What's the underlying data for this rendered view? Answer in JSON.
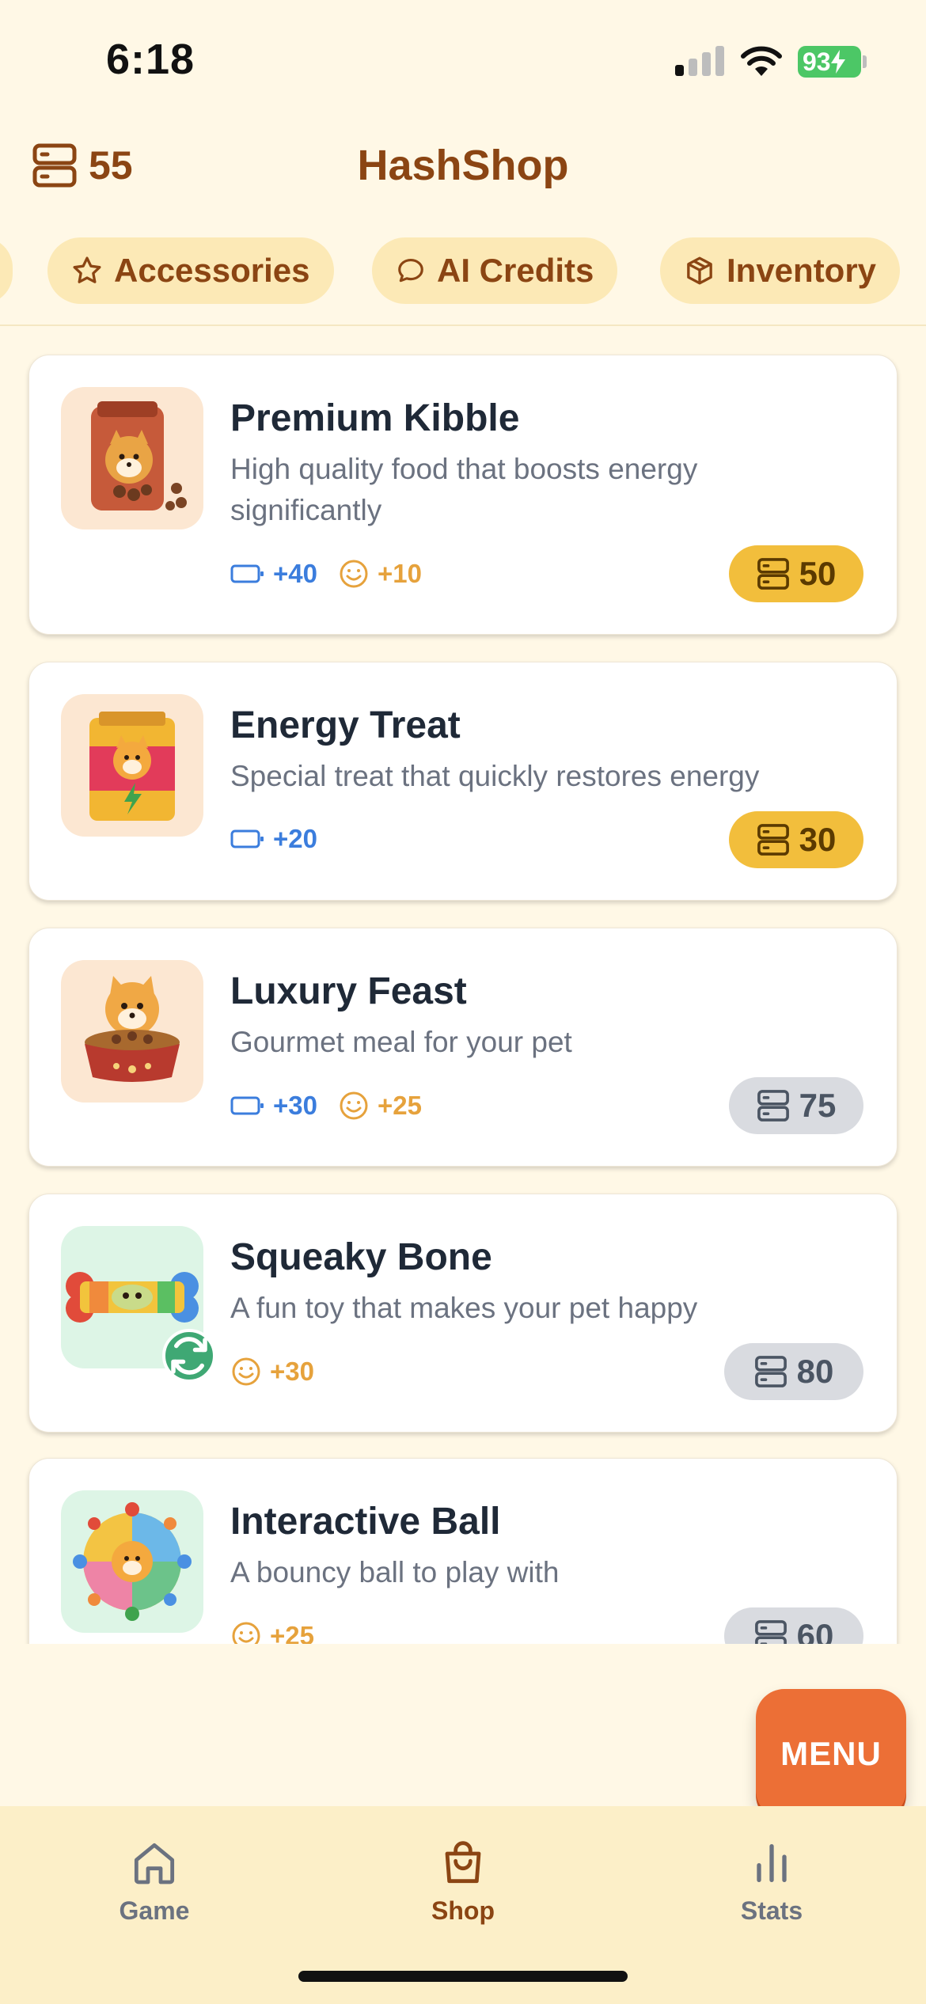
{
  "status_bar": {
    "time": "6:18",
    "battery": "93"
  },
  "header": {
    "coins": "55",
    "title": "HashShop"
  },
  "tabs": [
    {
      "label": "Accessories",
      "icon": "star-icon"
    },
    {
      "label": "AI Credits",
      "icon": "chat-bubble-icon"
    },
    {
      "label": "Inventory",
      "icon": "box-icon"
    }
  ],
  "products": [
    {
      "name": "Premium Kibble",
      "description": "High quality food that boosts energy significantly",
      "energy": "+40",
      "happiness": "+10",
      "price": "50",
      "affordable": true,
      "icon": "kibble-bag-icon"
    },
    {
      "name": "Energy Treat",
      "description": "Special treat that quickly restores energy",
      "energy": "+20",
      "price": "30",
      "affordable": true,
      "icon": "treat-bag-icon"
    },
    {
      "name": "Luxury Feast",
      "description": "Gourmet meal for your pet",
      "energy": "+30",
      "happiness": "+25",
      "price": "75",
      "affordable": false,
      "icon": "feast-bowl-icon"
    },
    {
      "name": "Squeaky Bone",
      "description": "A fun toy that makes your pet happy",
      "happiness": "+30",
      "price": "80",
      "affordable": false,
      "icon": "bone-toy-icon"
    },
    {
      "name": "Interactive Ball",
      "description": "A bouncy ball to play with",
      "happiness": "+25",
      "price": "60",
      "affordable": false,
      "icon": "ball-toy-icon"
    }
  ],
  "menu_label": "MENU",
  "nav": [
    {
      "label": "Game",
      "icon": "home-icon"
    },
    {
      "label": "Shop",
      "icon": "shopping-bag-icon",
      "active": true
    },
    {
      "label": "Stats",
      "icon": "bar-chart-icon"
    }
  ],
  "colors": {
    "background": "#FFF8E6",
    "brand_brown": "#8B4513",
    "price_gold": "#F2BE3C",
    "menu_orange": "#EC6F36",
    "energy_blue": "#3B7DDD",
    "happy_orange": "#E6A23C"
  }
}
